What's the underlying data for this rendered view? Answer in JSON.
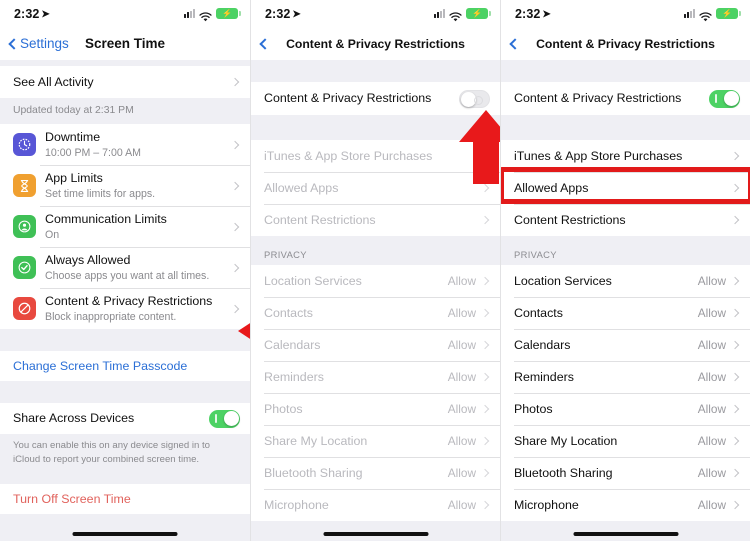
{
  "status_bar": {
    "time": "2:32",
    "location_arrow_icon": "location-arrow-icon",
    "signal_icon": "cellular-signal-icon",
    "wifi_icon": "wifi-icon",
    "battery_icon": "battery-charging-icon",
    "battery_bolt": "⚡"
  },
  "colors": {
    "accent_blue": "#2b6fd6",
    "green_toggle": "#4cd264",
    "annotation_red": "#e21a1a",
    "destructive_red": "#e1625c",
    "group_bg": "#efeff4"
  },
  "panel1": {
    "nav": {
      "back_label": "Settings",
      "title": "Screen Time"
    },
    "see_all_activity": {
      "label": "See All Activity"
    },
    "updated": "Updated today at 2:31 PM",
    "items": [
      {
        "title": "Downtime",
        "subtitle": "10:00 PM – 7:00 AM",
        "icon": "downtime-clock-icon",
        "icon_color": "#5856d6",
        "glyph": "◔"
      },
      {
        "title": "App Limits",
        "subtitle": "Set time limits for apps.",
        "icon": "hourglass-icon",
        "icon_color": "#f0a030",
        "glyph": "⧗"
      },
      {
        "title": "Communication Limits",
        "subtitle": "On",
        "icon": "person-circle-icon",
        "icon_color": "#3fc056",
        "glyph": "◉"
      },
      {
        "title": "Always Allowed",
        "subtitle": "Choose apps you want at all times.",
        "icon": "check-badge-icon",
        "icon_color": "#3fc056",
        "glyph": "✔"
      },
      {
        "title": "Content & Privacy Restrictions",
        "subtitle": "Block inappropriate content.",
        "icon": "prohibited-icon",
        "icon_color": "#e8493f",
        "glyph": "⃠"
      }
    ],
    "change_passcode": "Change Screen Time Passcode",
    "share_across_devices": {
      "label": "Share Across Devices",
      "toggle_state": "on"
    },
    "share_note": "You can enable this on any device signed in to iCloud to report your combined screen time.",
    "turn_off": "Turn Off Screen Time"
  },
  "panel2": {
    "nav": {
      "back_icon": "chevron-left-icon",
      "title": "Content & Privacy Restrictions"
    },
    "master_toggle": {
      "label": "Content & Privacy Restrictions",
      "state": "off"
    },
    "main_items": [
      {
        "label": "iTunes & App Store Purchases"
      },
      {
        "label": "Allowed Apps"
      },
      {
        "label": "Content Restrictions"
      }
    ],
    "privacy_header": "PRIVACY",
    "privacy_items": [
      {
        "label": "Location Services",
        "value": "Allow"
      },
      {
        "label": "Contacts",
        "value": "Allow"
      },
      {
        "label": "Calendars",
        "value": "Allow"
      },
      {
        "label": "Reminders",
        "value": "Allow"
      },
      {
        "label": "Photos",
        "value": "Allow"
      },
      {
        "label": "Share My Location",
        "value": "Allow"
      },
      {
        "label": "Bluetooth Sharing",
        "value": "Allow"
      },
      {
        "label": "Microphone",
        "value": "Allow"
      }
    ],
    "annotation": {
      "arrow_up_icon": "red-up-arrow-annotation",
      "points_at": "master-toggle"
    }
  },
  "panel3": {
    "nav": {
      "back_icon": "chevron-left-icon",
      "title": "Content & Privacy Restrictions"
    },
    "master_toggle": {
      "label": "Content & Privacy Restrictions",
      "state": "on"
    },
    "main_items": [
      {
        "label": "iTunes & App Store Purchases"
      },
      {
        "label": "Allowed Apps"
      },
      {
        "label": "Content Restrictions"
      }
    ],
    "privacy_header": "PRIVACY",
    "privacy_items": [
      {
        "label": "Location Services",
        "value": "Allow"
      },
      {
        "label": "Contacts",
        "value": "Allow"
      },
      {
        "label": "Calendars",
        "value": "Allow"
      },
      {
        "label": "Reminders",
        "value": "Allow"
      },
      {
        "label": "Photos",
        "value": "Allow"
      },
      {
        "label": "Share My Location",
        "value": "Allow"
      },
      {
        "label": "Bluetooth Sharing",
        "value": "Allow"
      },
      {
        "label": "Microphone",
        "value": "Allow"
      }
    ],
    "annotation": {
      "highlight_box": "red-rectangle-annotation",
      "highlights": "Allowed Apps"
    }
  },
  "annotations": {
    "panel1_arrow": {
      "icon": "red-left-arrow-annotation",
      "points_at": "Content & Privacy Restrictions"
    }
  }
}
